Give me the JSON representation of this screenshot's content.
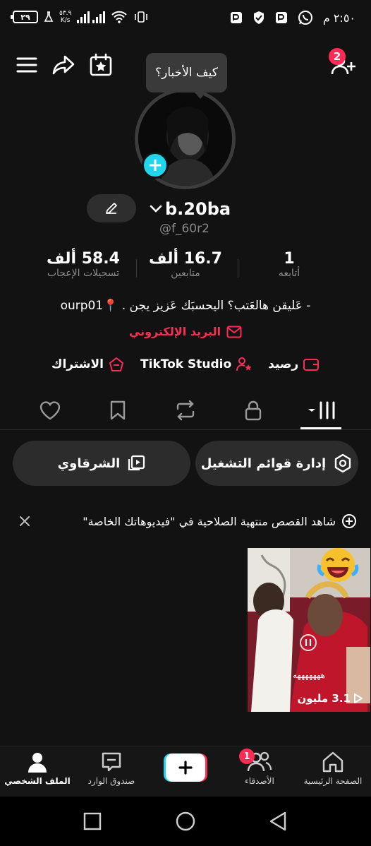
{
  "status_bar": {
    "time": "٢:٥٠ م",
    "battery": "٢٩",
    "speed_value": "٥٣.٩",
    "speed_unit": "K/s"
  },
  "header": {
    "bubble_text": "كيف الأخبار؟",
    "notification_count": "2"
  },
  "profile": {
    "username": "b.20ba",
    "handle": "@f_60r2",
    "stats": [
      {
        "value": "1",
        "label": "أتابعه"
      },
      {
        "value": "16.7 ألف",
        "label": "متابعين"
      },
      {
        "value": "58.4 ألف",
        "label": "تسجيلات الإعجاب"
      }
    ],
    "bio": "- عَليقن هالعَتب؟ اليحسبَك عَزيز يجن . 📍ourp01",
    "email_label": "البريد الإلكتروني",
    "links": [
      {
        "label": "رصيد",
        "icon": "wallet-icon"
      },
      {
        "label": "TikTok Studio",
        "icon": "creator-icon"
      },
      {
        "label": "الاشتراك",
        "icon": "subscription-icon"
      }
    ]
  },
  "tabs": [
    "videos-grid-icon",
    "lock-icon",
    "repost-icon",
    "bookmark-icon",
    "heart-icon"
  ],
  "pills": {
    "manage_playlists": "إدارة قوائم التشغيل",
    "playlist_name": "الشرقاوي"
  },
  "notice": {
    "text": "شاهد القصص منتهية الصلاحية في \"فيديوهاتك الخاصة\""
  },
  "video": {
    "caption": "هههههههه",
    "views": "3.1 مليون"
  },
  "bottom_nav": {
    "items": [
      {
        "label": "الصفحة الرئيسية",
        "icon": "home-icon"
      },
      {
        "label": "الأصدقاء",
        "icon": "friends-icon",
        "badge": "1"
      },
      {
        "label": "",
        "icon": "create-plus-icon"
      },
      {
        "label": "صندوق الوارد",
        "icon": "inbox-icon"
      },
      {
        "label": "الملف الشخصي",
        "icon": "profile-icon"
      }
    ]
  },
  "colors": {
    "accent": "#fe2c55",
    "cyan": "#20d5ec",
    "background": "#121212"
  }
}
